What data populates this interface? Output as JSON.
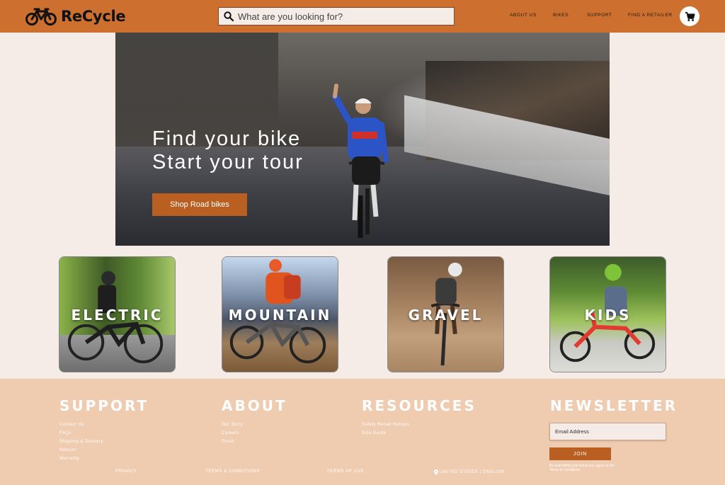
{
  "header": {
    "brand": "ReCycle",
    "search_placeholder": "What are you looking for?",
    "nav": [
      "ABOUT US",
      "BIKES",
      "SUPPORT",
      "FIND A RETAILER"
    ],
    "accent_color": "#cd6f2e"
  },
  "hero": {
    "line1": "Find your bike",
    "line2": "Start your tour",
    "button": "Shop Road bikes"
  },
  "categories": [
    "ELECTRIC",
    "MOUNTAIN",
    "GRAVEL",
    "KIDS"
  ],
  "footer": {
    "support": {
      "title": "SUPPORT",
      "links": [
        "Contact Us",
        "FAQs",
        "Shipping & Delivery",
        "Returns",
        "Warranty"
      ]
    },
    "about": {
      "title": "ABOUT",
      "links": [
        "Our Story",
        "Careers",
        "Press"
      ]
    },
    "resources": {
      "title": "RESOURCES",
      "links": [
        "Safety Recall Notices",
        "Size Guide"
      ]
    },
    "newsletter": {
      "title": "NEWSLETTER",
      "email_placeholder": "Email Address",
      "join": "JOIN",
      "disclaimer": "By submitting your email you agree to the Terms & Conditions"
    },
    "bottom": {
      "privacy": "PRIVACY",
      "terms_conditions": "TERMS & CONDITIONS",
      "terms_use": "TERMS OF USE",
      "locale": "UNITED STATES | ENGLISH"
    }
  }
}
